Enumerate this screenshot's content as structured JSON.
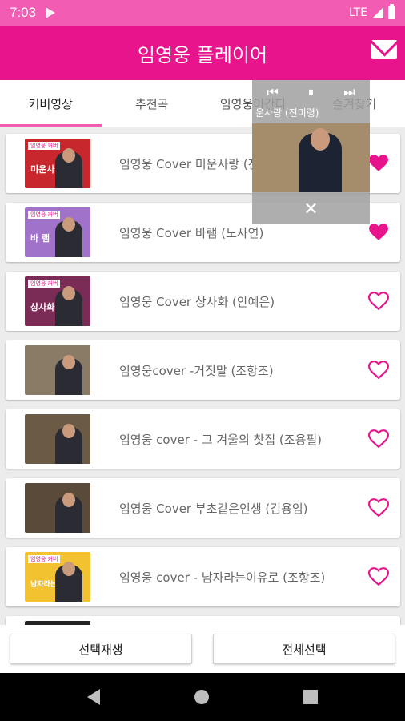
{
  "status": {
    "time": "7:03",
    "network": "LTE"
  },
  "appbar": {
    "title": "임영웅 플레이어",
    "mail_icon": "mail-icon"
  },
  "tabs": [
    {
      "label": "커버영상",
      "active": true
    },
    {
      "label": "추천곡",
      "active": false
    },
    {
      "label": "임영웅이간다",
      "active": false
    },
    {
      "label": "즐겨찾기",
      "active": false
    }
  ],
  "pip": {
    "subtitle": "운사랑 (진미령)"
  },
  "items": [
    {
      "title": "임영웅 Cover 미운사랑 (진미령)",
      "thumb_caption": "미운사랑",
      "thumb_tag": "임영웅 커버",
      "thumb_bg": "#c8282d",
      "favorite": true
    },
    {
      "title": "임영웅 Cover 바램 (노사연)",
      "thumb_caption": "바 램",
      "thumb_tag": "임영웅 커버",
      "thumb_bg": "#a072c9",
      "favorite": true
    },
    {
      "title": "임영웅 Cover 상사화 (안예은)",
      "thumb_caption": "상사화",
      "thumb_tag": "임영웅 커버",
      "thumb_bg": "#7a2c57",
      "favorite": false
    },
    {
      "title": "임영웅cover -거짓말 (조항조)",
      "thumb_caption": "",
      "thumb_tag": "",
      "thumb_bg": "#8a7b66",
      "favorite": false
    },
    {
      "title": "임영웅 cover - 그 겨울의 찻집 (조용필)",
      "thumb_caption": "",
      "thumb_tag": "",
      "thumb_bg": "#6b5b45",
      "favorite": false
    },
    {
      "title": "임영웅 Cover 부초같은인생 (김용임)",
      "thumb_caption": "",
      "thumb_tag": "",
      "thumb_bg": "#5a4a3a",
      "favorite": false
    },
    {
      "title": "임영웅 cover - 남자라는이유로 (조항조)",
      "thumb_caption": "남자라는 이유로",
      "thumb_tag": "임영웅 커버",
      "thumb_bg": "#f2c230",
      "favorite": false
    }
  ],
  "buttons": {
    "play_selected": "선택재생",
    "select_all": "전체선택"
  },
  "colors": {
    "accent": "#e8148c",
    "status": "#f25cb3"
  }
}
